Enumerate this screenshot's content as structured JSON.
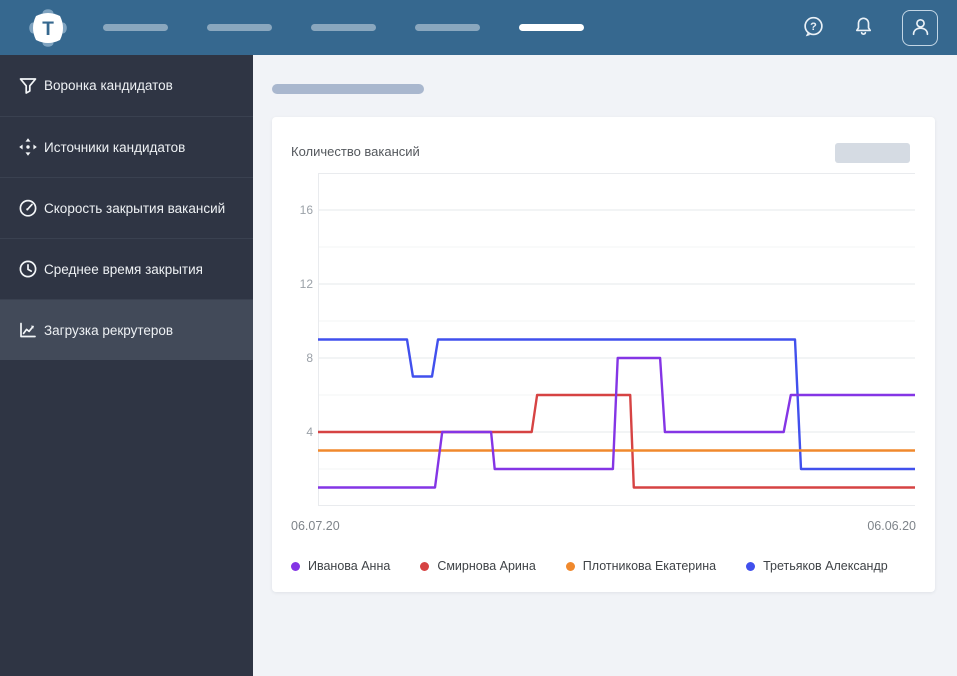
{
  "navbar": {
    "logo_letter": "T",
    "help_icon_char": "?",
    "placeholder_bars": [
      "inactive",
      "inactive",
      "inactive",
      "inactive",
      "active"
    ],
    "colors": {
      "background": "#36688F",
      "inactive_bar": "#8FA9C2",
      "active_bar": "#FFFFFF"
    }
  },
  "sidebar": {
    "colors": {
      "background": "#2F3544",
      "selected": "#424A59",
      "divider": "#3A4150"
    },
    "items": [
      {
        "label": "Воронка кандидатов",
        "icon": "funnel-icon",
        "selected": false
      },
      {
        "label": "Источники кандидатов",
        "icon": "move-icon",
        "selected": false
      },
      {
        "label": "Скорость закрытия вакансий",
        "icon": "gauge-icon",
        "selected": false
      },
      {
        "label": "Среднее время закрытия",
        "icon": "clock-icon",
        "selected": false
      },
      {
        "label": "Загрузка рекрутеров",
        "icon": "line-chart-icon",
        "selected": true
      }
    ]
  },
  "chart_data": {
    "type": "line",
    "subtype": "step",
    "title": "Количество вакансий",
    "x_axis": {
      "left_label": "06.07.20",
      "right_label": "06.06.20"
    },
    "y_axis": {
      "min": 0,
      "max": 18,
      "labeled_ticks": [
        4,
        8,
        12,
        16
      ],
      "gridline_step": 2
    },
    "grid": {
      "labeled_line_color": "#E6E8EB",
      "minor_line_color": "#F3F4F6",
      "border_color": "#E9EBEE"
    },
    "series": [
      {
        "name": "Третьяков Александр",
        "color": "#4150ED",
        "points": [
          [
            0,
            9
          ],
          [
            0.149,
            9
          ],
          [
            0.159,
            7
          ],
          [
            0.191,
            7
          ],
          [
            0.201,
            9
          ],
          [
            0.799,
            9
          ],
          [
            0.809,
            2
          ],
          [
            1,
            2
          ]
        ]
      },
      {
        "name": "Смирнова Арина",
        "color": "#D64343",
        "points": [
          [
            0,
            4
          ],
          [
            0.358,
            4
          ],
          [
            0.367,
            6
          ],
          [
            0.523,
            6
          ],
          [
            0.529,
            1
          ],
          [
            1,
            1
          ]
        ]
      },
      {
        "name": "Плотникова Екатерина",
        "color": "#F0892D",
        "points": [
          [
            0,
            3
          ],
          [
            1,
            3
          ]
        ]
      },
      {
        "name": "Иванова Анна",
        "color": "#8435E5",
        "points": [
          [
            0,
            1
          ],
          [
            0.196,
            1
          ],
          [
            0.208,
            4
          ],
          [
            0.29,
            4
          ],
          [
            0.296,
            2
          ],
          [
            0.494,
            2
          ],
          [
            0.502,
            8
          ],
          [
            0.573,
            8
          ],
          [
            0.581,
            4
          ],
          [
            0.78,
            4
          ],
          [
            0.792,
            6
          ],
          [
            1,
            6
          ]
        ]
      }
    ],
    "legend": [
      {
        "label": "Иванова Анна",
        "color": "#8435E5"
      },
      {
        "label": "Смирнова Арина",
        "color": "#D64343"
      },
      {
        "label": "Плотникова Екатерина",
        "color": "#F0892D"
      },
      {
        "label": "Третьяков Александр",
        "color": "#4150ED"
      }
    ],
    "legend_position": "bottom-left"
  }
}
